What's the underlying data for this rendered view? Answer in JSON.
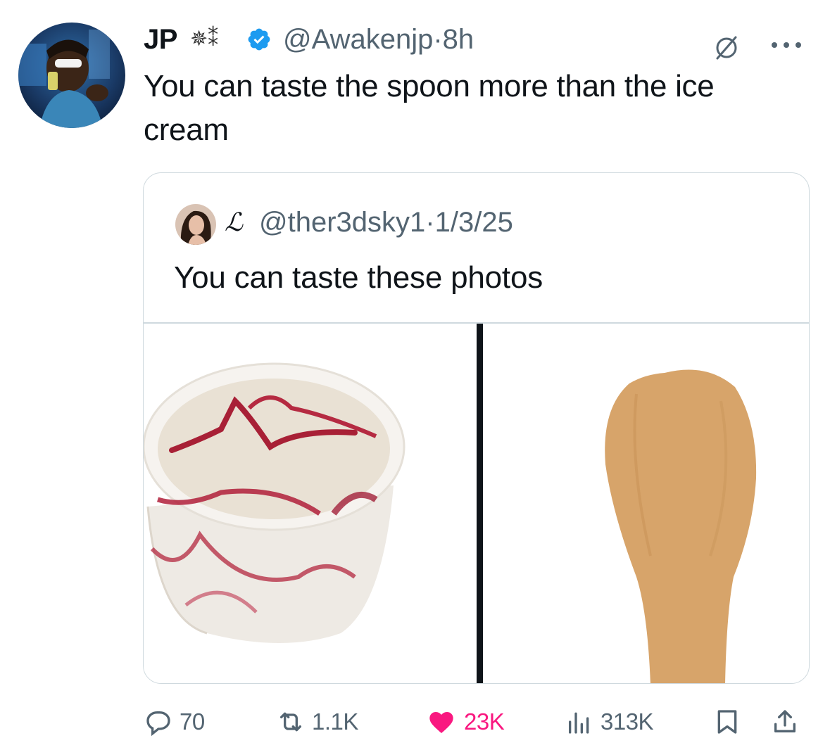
{
  "tweet": {
    "author_name": "JP",
    "name_glyphs": "✵⁑",
    "handle": "@Awakenjp",
    "time": "8h",
    "separator": "·",
    "text": "You can taste the spoon more than the ice cream"
  },
  "quoted": {
    "script_initial": "ℒ",
    "handle": "@ther3dsky1",
    "date": "1/3/25",
    "separator": "·",
    "text": "You can taste these photos"
  },
  "actions": {
    "replies": "70",
    "reposts": "1.1K",
    "likes": "23K",
    "views": "313K"
  },
  "colors": {
    "text": "#0f1419",
    "secondary": "#536471",
    "verified": "#1d9bf0",
    "like": "#f91880",
    "border": "#cfd9de"
  },
  "icons": [
    "verified-badge-icon",
    "grok-icon",
    "more-icon",
    "reply-icon",
    "repost-icon",
    "like-icon",
    "views-icon",
    "bookmark-icon",
    "share-icon"
  ]
}
